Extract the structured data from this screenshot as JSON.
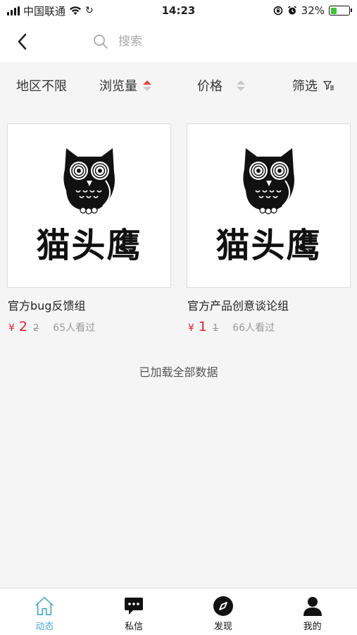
{
  "status_bar": {
    "carrier": "中国联通",
    "time": "14:23",
    "battery": "32%",
    "battery_level": 0.32
  },
  "header": {
    "search_placeholder": "搜索"
  },
  "filters": {
    "region": "地区不限",
    "views": "浏览量",
    "price": "价格",
    "screen": "筛选"
  },
  "cards": [
    {
      "logo_text": "猫头鹰",
      "title": "官方bug反馈组",
      "currency": "¥",
      "price_now": "2",
      "price_old": "2",
      "views": "65人看过"
    },
    {
      "logo_text": "猫头鹰",
      "title": "官方产品创意谈论组",
      "currency": "¥",
      "price_now": "1",
      "price_old": "1",
      "views": "66人看过"
    }
  ],
  "loaded_note": "已加载全部数据",
  "tabs": [
    {
      "label": "动态",
      "icon": "home-icon",
      "active": true
    },
    {
      "label": "私信",
      "icon": "chat-icon",
      "active": false
    },
    {
      "label": "发现",
      "icon": "compass-icon",
      "active": false
    },
    {
      "label": "我的",
      "icon": "person-icon",
      "active": false
    }
  ],
  "colors": {
    "accent": "#4aa8c9",
    "price": "#dd2233",
    "sort_active": "#e0463c"
  }
}
